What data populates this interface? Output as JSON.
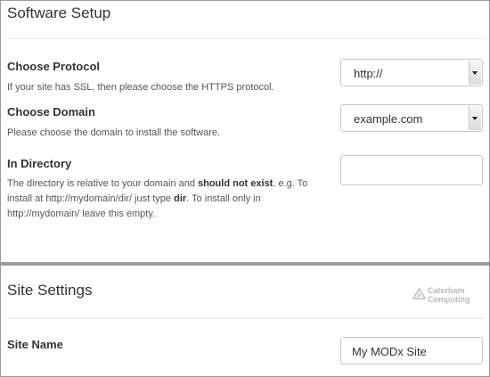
{
  "software_setup": {
    "title": "Software Setup",
    "protocol": {
      "label": "Choose Protocol",
      "help": "If your site has SSL, then please choose the HTTPS protocol.",
      "value": "http://"
    },
    "domain": {
      "label": "Choose Domain",
      "help": "Please choose the domain to install the software.",
      "value": "example.com"
    },
    "directory": {
      "label": "In Directory",
      "help_1": "The directory is relative to your domain and ",
      "help_bold_1": "should not exist",
      "help_2": ". e.g. To install at http://mydomain/dir/ just type ",
      "help_bold_2": "dir",
      "help_3": ". To install only in http://mydomain/ leave this empty.",
      "value": ""
    }
  },
  "site_settings": {
    "title": "Site Settings",
    "logo_line_1": "Caterham",
    "logo_line_2": "Computing",
    "site_name": {
      "label": "Site Name",
      "value": "My MODx Site"
    }
  }
}
